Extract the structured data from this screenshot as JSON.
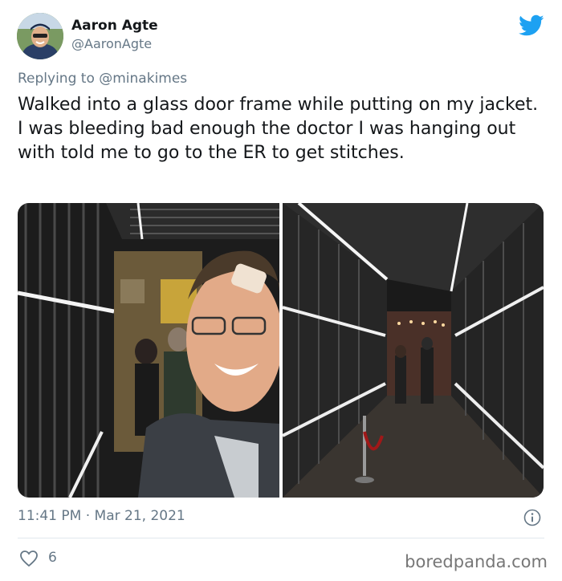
{
  "author": {
    "name": "Aaron Agte",
    "handle": "@AaronAgte"
  },
  "reply": {
    "prefix": "Replying to ",
    "mention": "@minakimes"
  },
  "tweet": {
    "text": "Walked into a glass door frame while putting on my jacket. I was bleeding bad enough the doctor I was hanging out with told me to go to the ER to get stitches."
  },
  "meta": {
    "timestamp": "11:41 PM · Mar 21, 2021"
  },
  "stats": {
    "likes": "6"
  },
  "watermark": "boredpanda.com",
  "icons": {
    "brand": "twitter-bird-icon",
    "info": "info-icon",
    "like": "heart-icon"
  },
  "colors": {
    "twitter_blue": "#1da1f2",
    "secondary_text": "#657786",
    "divider": "#e1e8ed"
  }
}
